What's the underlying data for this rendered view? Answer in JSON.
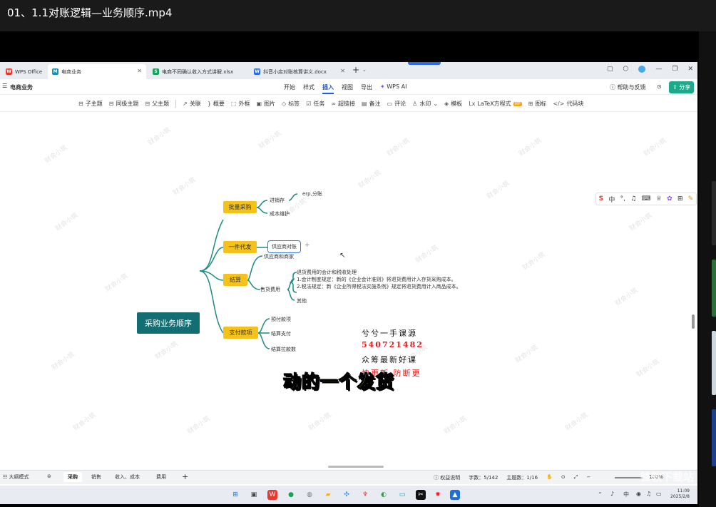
{
  "player": {
    "title": "01、1.1对账逻辑—业务顺序.mp4"
  },
  "tabs": [
    {
      "label": "WPS Office",
      "icon": "wps-logo-icon",
      "color": "#e8392f"
    },
    {
      "label": "电商业务",
      "icon": "mindmap-doc-icon",
      "color": "#1a8fb3"
    },
    {
      "label": "电商不同确认收入方式讲解.xlsx",
      "icon": "sheet-icon",
      "color": "#1e9e5a"
    },
    {
      "label": "抖音小店对账核算讲义.docx",
      "icon": "word-icon",
      "color": "#2c6ae6"
    }
  ],
  "menubar": {
    "doc_title": "电商业务",
    "menus": [
      "开始",
      "样式",
      "插入",
      "视图",
      "导出",
      "WPS AI"
    ],
    "active_menu": "插入",
    "help": "帮助与反馈",
    "share": "分享"
  },
  "toolbar": [
    {
      "label": "子主题",
      "icon": "subtopic-icon"
    },
    {
      "label": "同级主题",
      "icon": "sibling-topic-icon"
    },
    {
      "label": "父主题",
      "icon": "parent-topic-icon"
    },
    {
      "label": "关联",
      "icon": "link-relation-icon"
    },
    {
      "label": "概要",
      "icon": "summary-brace-icon"
    },
    {
      "label": "外框",
      "icon": "frame-icon"
    },
    {
      "label": "图片",
      "icon": "image-icon"
    },
    {
      "label": "标签",
      "icon": "tag-icon"
    },
    {
      "label": "任务",
      "icon": "task-icon"
    },
    {
      "label": "超链接",
      "icon": "hyperlink-icon"
    },
    {
      "label": "备注",
      "icon": "note-icon"
    },
    {
      "label": "评论",
      "icon": "comment-icon"
    },
    {
      "label": "水印",
      "icon": "watermark-icon"
    },
    {
      "label": "模板",
      "icon": "template-icon"
    },
    {
      "label": "LaTeX方程式",
      "icon": "latex-icon"
    },
    {
      "label": "图标",
      "icon": "icon-grid-icon"
    },
    {
      "label": "代码块",
      "icon": "code-block-icon"
    }
  ],
  "watermark_text": "财会小筑",
  "mindmap": {
    "root": "采购业务顺序",
    "b1": {
      "label": "批量采购",
      "children": [
        "进销存",
        "成本维护"
      ],
      "grandchild": "erp,分账"
    },
    "b2": {
      "label": "一件代发",
      "child": "供应商对账"
    },
    "b3": {
      "label": "结算",
      "children": [
        "供应商和商家",
        "售货费用"
      ],
      "details": [
        "退货费用的会计和税收处理",
        "1.会计制度规定：新的《企业会计准则》将退货费用计入存货采购成本。",
        "2.税法规定：新《企业所得税法实施条例》规定将退货费用计入商品成本。",
        "其他"
      ]
    },
    "b4": {
      "label": "支付款项",
      "children": [
        "预付款项",
        "结算支付",
        "结算拉款数"
      ]
    }
  },
  "promo": {
    "line1": "兮兮一手课源",
    "line2": "540721482",
    "line3": "众筹最新好课",
    "line4": "快更新 防断更"
  },
  "subtitle": "动的一个发货",
  "statusbar": {
    "outline": "大纲模式",
    "sheets": [
      "采购",
      "销售",
      "收入、成本",
      "费用"
    ],
    "active_sheet": "采购",
    "rights": "权益说明",
    "word_count": "字数：5/142",
    "topic_count": "主题数：1/16",
    "zoom": "100%"
  },
  "clock": {
    "time": "11:09",
    "date": "2025/2/8"
  },
  "site_watermark": "锋软下载站"
}
